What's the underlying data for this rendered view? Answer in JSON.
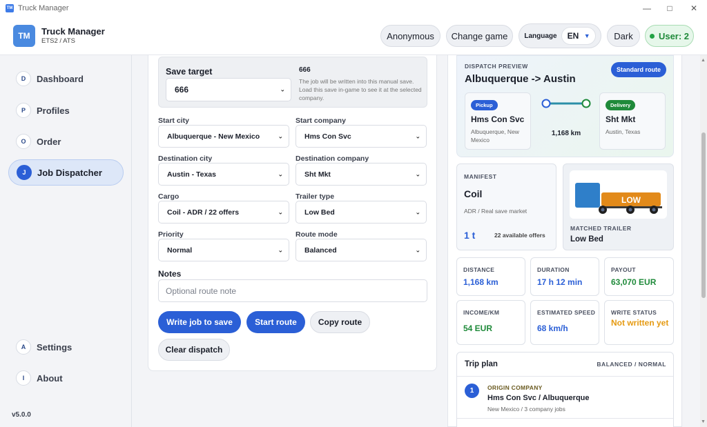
{
  "window": {
    "title": "Truck Manager"
  },
  "header": {
    "logo": "TM",
    "app_name": "Truck Manager",
    "subtitle": "ETS2 / ATS",
    "anonymous_label": "Anonymous",
    "change_game_label": "Change game",
    "language_label": "Language",
    "language_value": "EN",
    "theme_label": "Dark",
    "user_label": "User: 2"
  },
  "sidebar": {
    "items": [
      {
        "badge": "D",
        "label": "Dashboard"
      },
      {
        "badge": "P",
        "label": "Profiles"
      },
      {
        "badge": "O",
        "label": "Order"
      },
      {
        "badge": "J",
        "label": "Job Dispatcher"
      }
    ],
    "bottom_items": [
      {
        "badge": "A",
        "label": "Settings"
      },
      {
        "badge": "I",
        "label": "About"
      }
    ],
    "version": "v5.0.0"
  },
  "form": {
    "save_target": {
      "label": "Save target",
      "value": "666",
      "title": "666",
      "description": "The job will be written into this manual save. Load this save in-game to see it at the selected company."
    },
    "start_city": {
      "label": "Start city",
      "value": "Albuquerque - New Mexico"
    },
    "start_company": {
      "label": "Start company",
      "value": "Hms Con Svc"
    },
    "destination_city": {
      "label": "Destination city",
      "value": "Austin - Texas"
    },
    "destination_company": {
      "label": "Destination company",
      "value": "Sht Mkt"
    },
    "cargo": {
      "label": "Cargo",
      "value": "Coil - ADR / 22 offers"
    },
    "trailer_type": {
      "label": "Trailer type",
      "value": "Low Bed"
    },
    "priority": {
      "label": "Priority",
      "value": "Normal"
    },
    "route_mode": {
      "label": "Route mode",
      "value": "Balanced"
    },
    "notes": {
      "label": "Notes",
      "placeholder": "Optional route note",
      "value": ""
    },
    "buttons": {
      "write_job": "Write job to save",
      "start_route": "Start route",
      "copy_route": "Copy route",
      "clear_dispatch": "Clear dispatch"
    }
  },
  "preview": {
    "kicker": "DISPATCH PREVIEW",
    "title": "Albuquerque -> Austin",
    "route_badge": "Standard route",
    "pickup": {
      "tag": "Pickup",
      "name": "Hms Con Svc",
      "location": "Albuquerque, New Mexico"
    },
    "delivery": {
      "tag": "Delivery",
      "name": "Sht Mkt",
      "location": "Austin, Texas"
    },
    "distance": "1,168 km",
    "manifest": {
      "kicker": "MANIFEST",
      "cargo": "Coil",
      "sub": "ADR / Real save market",
      "weight": "1 t",
      "offers": "22 available offers"
    },
    "trailer": {
      "kicker": "MATCHED TRAILER",
      "name": "Low Bed",
      "image_label": "LOW"
    },
    "stats": [
      {
        "label": "DISTANCE",
        "value": "1,168 km",
        "color": "#2b5fd6"
      },
      {
        "label": "DURATION",
        "value": "17 h 12 min",
        "color": "#2b5fd6"
      },
      {
        "label": "PAYOUT",
        "value": "63,070 EUR",
        "color": "#1f8a3a"
      },
      {
        "label": "INCOME/KM",
        "value": "54 EUR",
        "color": "#1f8a3a"
      },
      {
        "label": "ESTIMATED SPEED",
        "value": "68 km/h",
        "color": "#2b5fd6"
      },
      {
        "label": "WRITE STATUS",
        "value": "Not written yet",
        "color": "#e59a12"
      }
    ],
    "trip_plan": {
      "title": "Trip plan",
      "mode": "BALANCED / NORMAL",
      "steps": [
        {
          "num": "1",
          "kicker": "ORIGIN COMPANY",
          "title": "Hms Con Svc / Albuquerque",
          "sub": "New Mexico / 3 company jobs"
        }
      ]
    }
  },
  "colors": {
    "accent": "#2b5fd6",
    "success": "#1f8a3a",
    "warning": "#e59a12",
    "pickup_tag": "#2b5fd6",
    "delivery_tag": "#1f8a3a"
  }
}
